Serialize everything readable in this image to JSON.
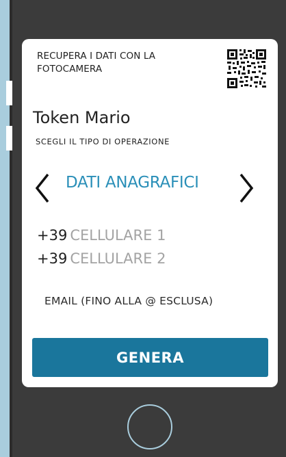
{
  "camera": {
    "text": "RECUPERA I DATI CON LA\nFOTOCAMERA",
    "qr_icon": "qr-code-icon"
  },
  "user": {
    "name": "Token Mario"
  },
  "operation": {
    "label": "SCEGLI IL TIPO DI OPERAZIONE",
    "title": "DATI ANAGRAFICI",
    "prev_icon": "chevron-left-icon",
    "next_icon": "chevron-right-icon"
  },
  "phones": [
    {
      "prefix": "+39",
      "placeholder": "CELLULARE 1"
    },
    {
      "prefix": "+39",
      "placeholder": "CELLULARE 2"
    }
  ],
  "email": {
    "placeholder": "EMAIL (FINO ALLA @ ESCLUSA)"
  },
  "button": {
    "label": "GENERA"
  },
  "colors": {
    "accent_text": "#2a8fb8",
    "button_bg": "#1a769c",
    "frame": "#3b3b3b",
    "edge": "#a9cddd",
    "placeholder": "#a3a3a3"
  }
}
